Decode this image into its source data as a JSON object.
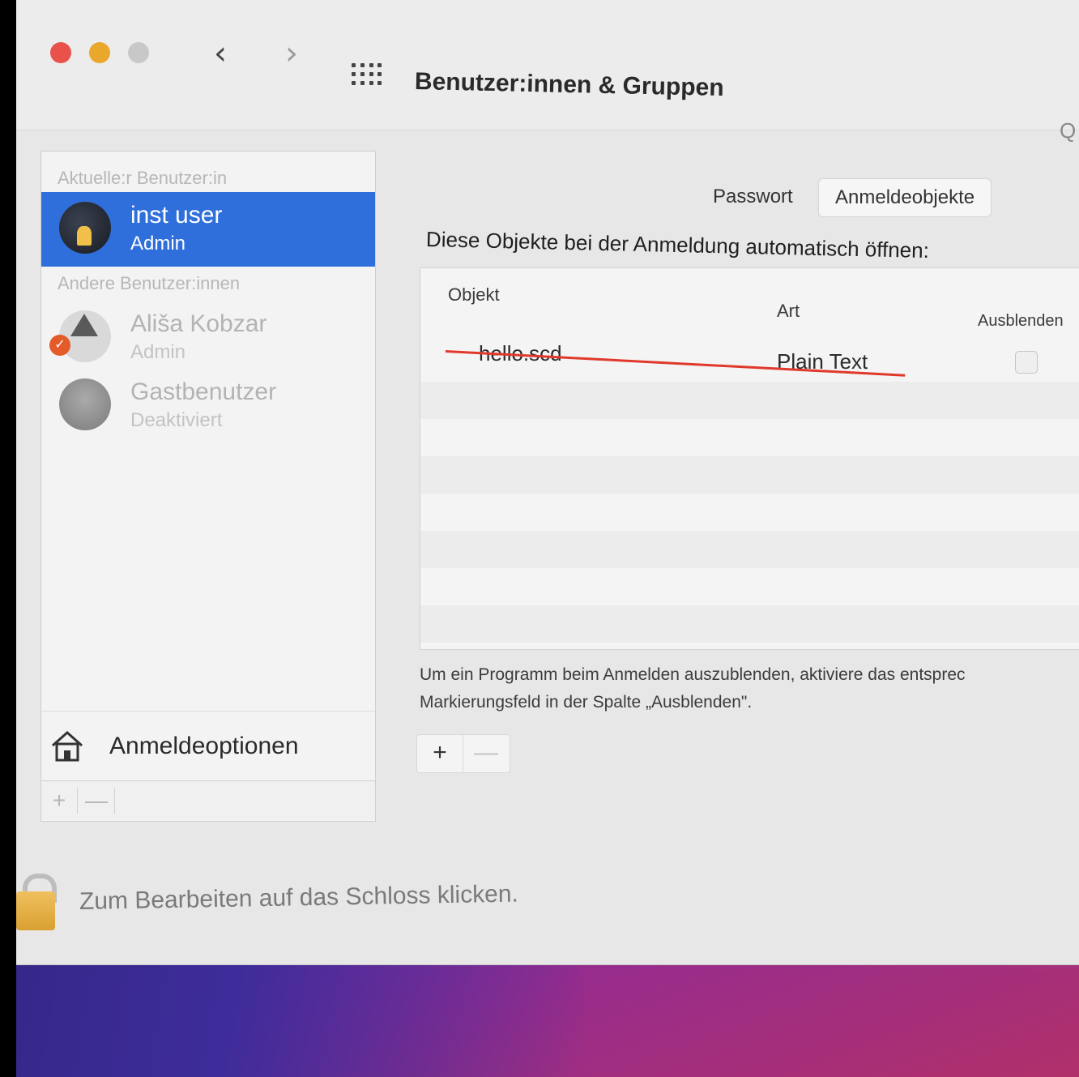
{
  "window": {
    "title": "Benutzer:innen & Gruppen",
    "back_glyph": "‹",
    "forward_glyph": "›",
    "search_glyph": "Q"
  },
  "sidebar": {
    "current_section": "Aktuelle:r Benutzer:in",
    "others_section": "Andere Benutzer:innen",
    "users": [
      {
        "name": "inst user",
        "role": "Admin",
        "selected": true
      },
      {
        "name": "Ališa Kobzar",
        "role": "Admin",
        "selected": false
      },
      {
        "name": "Gastbenutzer",
        "role": "Deaktiviert",
        "selected": false
      }
    ],
    "login_options": "Anmeldeoptionen",
    "add_glyph": "+",
    "remove_glyph": "—"
  },
  "main": {
    "tabs": [
      {
        "label": "Passwort"
      },
      {
        "label": "Anmeldeobjekte",
        "selected": true
      }
    ],
    "intro": "Diese Objekte bei der Anmeldung automatisch öffnen:",
    "columns": {
      "object": "Objekt",
      "type": "Art",
      "hide": "Ausblenden"
    },
    "rows": [
      {
        "object": "hello.scd",
        "type": "Plain Text",
        "hide": false
      }
    ],
    "help_line1": "Um ein Programm beim Anmelden auszublenden, aktiviere das entsprec",
    "help_line2": "Markierungsfeld in der Spalte „Ausblenden\".",
    "add_glyph": "+",
    "remove_glyph": "—"
  },
  "lock": {
    "text": "Zum Bearbeiten auf das Schloss klicken."
  },
  "colors": {
    "selection": "#2f6fdb",
    "annotation": "#e0392b"
  }
}
